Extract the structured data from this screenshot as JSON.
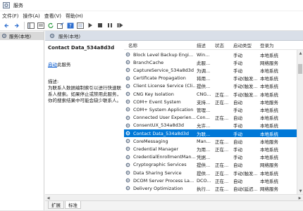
{
  "window": {
    "title": "服务"
  },
  "menu": [
    "文件(F)",
    "操作(A)",
    "查看(V)",
    "帮助(H)"
  ],
  "toolbar": [
    "back-icon",
    "forward-icon",
    "console-tree-icon",
    "properties-icon",
    "refresh-icon",
    "export-icon",
    "help-icon",
    "view-icon",
    "start-icon",
    "stop-icon",
    "pause-icon",
    "restart-icon"
  ],
  "tree": {
    "item": "服务(本地)"
  },
  "header": {
    "label": "服务(本地)"
  },
  "description_pane": {
    "service_name": "Contact Data_534a8d3d",
    "link": "启动",
    "link_suffix": "此服务",
    "desc_label": "描述:",
    "desc_text": "为联系人数据编制索引以进行快速联系人搜索。如果停止或禁用此服务，你的搜索结果中可能会缺少联系人。"
  },
  "columns": {
    "name": "名称",
    "desc": "描述",
    "status": "状态",
    "start": "启动类型",
    "logon": "登录为"
  },
  "services": [
    {
      "name": "Block Level Backup Engi...",
      "desc": "Win...",
      "status": "",
      "start": "手动",
      "logon": "本地系统"
    },
    {
      "name": "BranchCache",
      "desc": "此服...",
      "status": "",
      "start": "手动",
      "logon": "网络服务"
    },
    {
      "name": "CaptureService_534a8d3d",
      "desc": "为调...",
      "status": "",
      "start": "手动",
      "logon": "本地系统"
    },
    {
      "name": "Certificate Propagation",
      "desc": "将用...",
      "status": "",
      "start": "手动(触发...",
      "logon": "本地系统"
    },
    {
      "name": "Client License Service (Cli...",
      "desc": "提供...",
      "status": "",
      "start": "手动(触发...",
      "logon": "本地系统"
    },
    {
      "name": "CNG Key Isolation",
      "desc": "CNG...",
      "status": "正在...",
      "start": "手动(触发...",
      "logon": "本地系统"
    },
    {
      "name": "COM+ Event System",
      "desc": "支持...",
      "status": "正在...",
      "start": "自动",
      "logon": "本地服务"
    },
    {
      "name": "COM+ System Application",
      "desc": "管理...",
      "status": "",
      "start": "手动",
      "logon": "本地系统"
    },
    {
      "name": "Connected User Experien...",
      "desc": "Con...",
      "status": "正在...",
      "start": "自动",
      "logon": "本地系统"
    },
    {
      "name": "ConsentUX_534a8d3d",
      "desc": "允许...",
      "status": "",
      "start": "手动",
      "logon": "本地系统"
    },
    {
      "name": "Contact Data_534a8d3d",
      "desc": "为联...",
      "status": "",
      "start": "手动",
      "logon": "本地系统",
      "selected": true
    },
    {
      "name": "CoreMessaging",
      "desc": "Man...",
      "status": "正在...",
      "start": "自动",
      "logon": "本地服务"
    },
    {
      "name": "Credential Manager",
      "desc": "为用...",
      "status": "正在...",
      "start": "手动",
      "logon": "本地系统"
    },
    {
      "name": "CredentialEnrollmentMan...",
      "desc": "凭据...",
      "status": "",
      "start": "手动",
      "logon": "本地系统"
    },
    {
      "name": "Cryptographic Services",
      "desc": "提供...",
      "status": "正在...",
      "start": "自动",
      "logon": "网络服务"
    },
    {
      "name": "Data Sharing Service",
      "desc": "提供...",
      "status": "正在...",
      "start": "手动(触发...",
      "logon": "本地系统"
    },
    {
      "name": "DCOM Server Process La...",
      "desc": "DCO...",
      "status": "正在...",
      "start": "自动",
      "logon": "本地系统"
    },
    {
      "name": "Delivery Optimization",
      "desc": "执行...",
      "status": "正在...",
      "start": "自动(延迟...",
      "logon": "网络服务"
    }
  ],
  "tabs": [
    "扩展",
    "标准"
  ],
  "colors": {
    "selection": "#0078d7",
    "header_band": "#d9dfe8",
    "link": "#0055cc"
  }
}
